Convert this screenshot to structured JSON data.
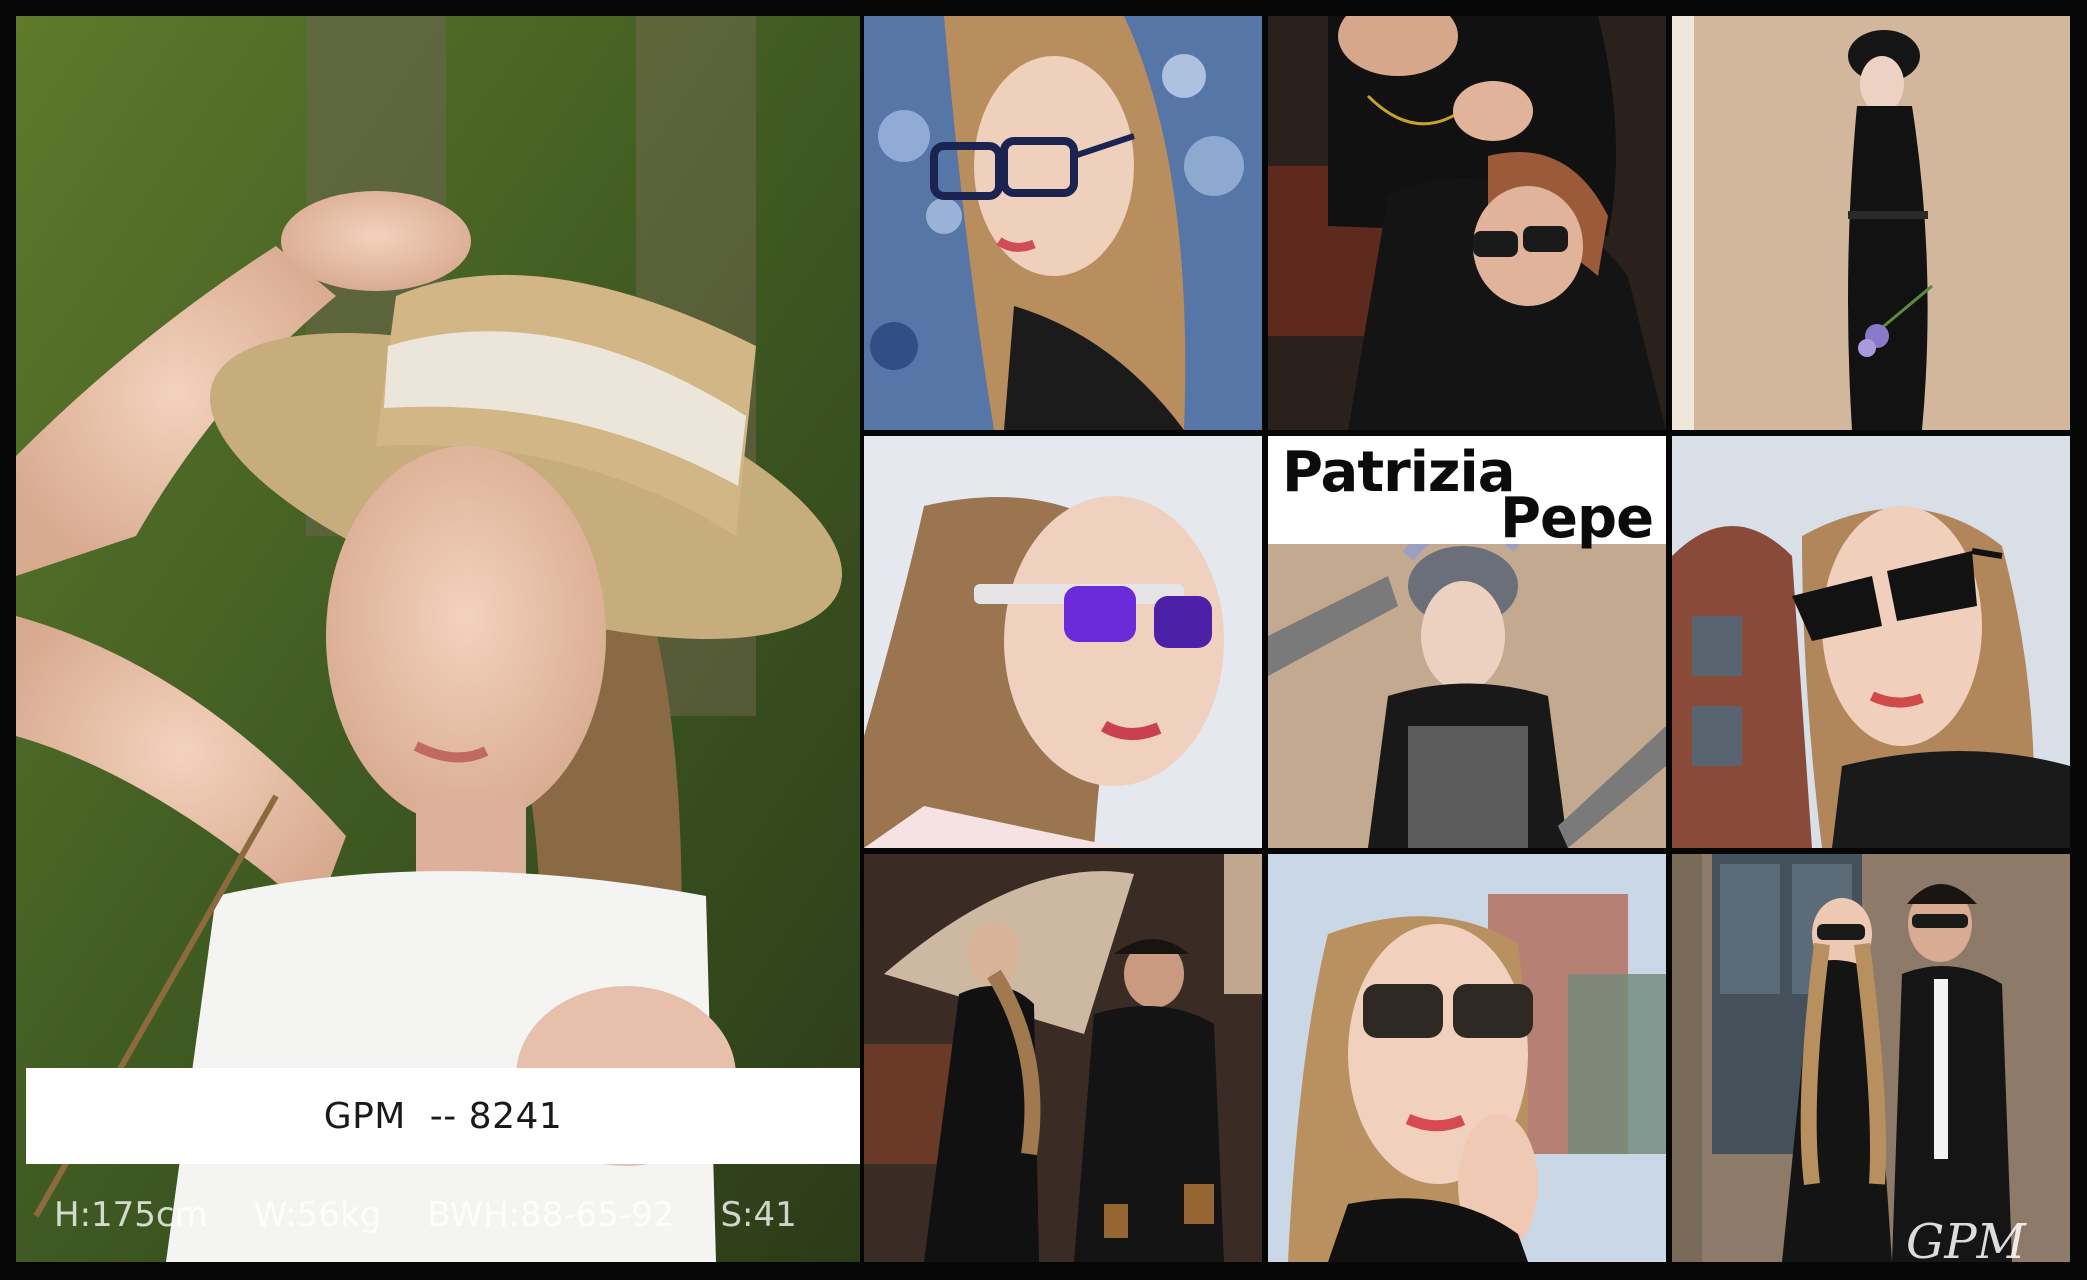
{
  "collage": {
    "caption": "GPM  -- 8241",
    "specs": [
      "H:175cm",
      "W:56kg",
      "BWH:88-65-92",
      "S:41"
    ],
    "brand_line1": "Patrizia",
    "brand_line2": "Pepe",
    "signature": "GPM"
  },
  "colors": {
    "frame": "#060606",
    "caption_bg": "#ffffff",
    "lens_purple": "#6b2bd9"
  }
}
